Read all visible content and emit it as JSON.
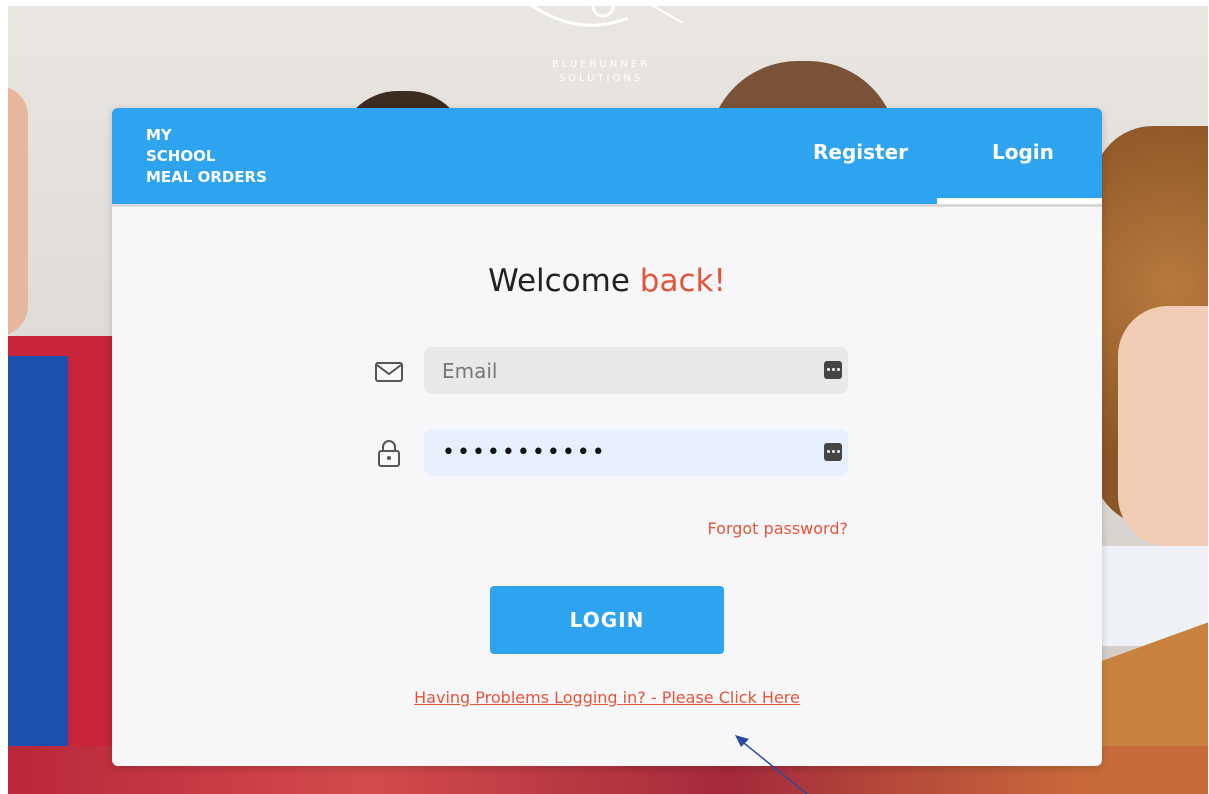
{
  "brand": {
    "line1": "BLUERUNNER",
    "line2": "SOLUTIONS"
  },
  "header": {
    "title_lines": [
      "MY",
      "SCHOOL",
      "MEAL ORDERS"
    ],
    "tabs": [
      {
        "label": "Register",
        "active": false
      },
      {
        "label": "Login",
        "active": true
      }
    ]
  },
  "welcome": {
    "text": "Welcome",
    "accent": "back!"
  },
  "form": {
    "email": {
      "icon": "envelope-icon",
      "placeholder": "Email",
      "value": ""
    },
    "password": {
      "icon": "lock-icon",
      "value": "•••••••••••"
    },
    "forgot_label": "Forgot password?",
    "submit_label": "LOGIN",
    "help_label": "Having Problems Logging in? - Please Click Here"
  },
  "colors": {
    "primary": "#2ea4f0",
    "accent": "#e2553a",
    "card": "#f7f7fa"
  }
}
